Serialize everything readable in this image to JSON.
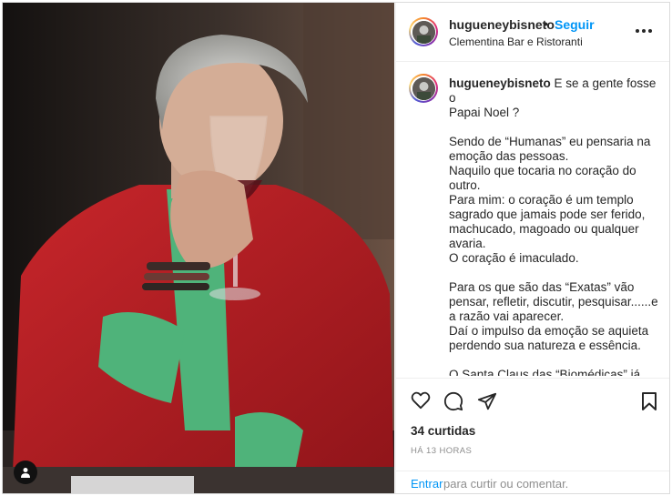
{
  "post": {
    "username": "hugueneybisneto",
    "separator": "•",
    "follow_label": "Seguir",
    "location": "Clementina Bar e Ristoranti",
    "more_icon": "more-horizontal-icon"
  },
  "caption": {
    "username": "hugueneybisneto",
    "lines": [
      "E se a gente fosse o",
      "Papai Noel ?",
      "",
      "Sendo de “Humanas” eu pensaria na",
      "emoção das pessoas.",
      "Naquilo que tocaria no coração do",
      "outro.",
      "Para mim: o coração é um templo",
      "sagrado que jamais pode ser ferido,",
      "machucado, magoado ou qualquer",
      "avaria.",
      "O coração é imaculado.",
      "",
      "Para os que são das “Exatas” vão",
      "pensar, refletir, discutir, pesquisar......e",
      "a razão vai aparecer.",
      "Daí o impulso da emoção se aquieta",
      "perdendo sua natureza e essência.",
      "",
      "O Santa Claus das “Biomédicas” já iria"
    ]
  },
  "actions": {
    "like_icon": "heart-icon",
    "comment_icon": "comment-icon",
    "share_icon": "share-icon",
    "save_icon": "bookmark-icon"
  },
  "likes": "34 curtidas",
  "timestamp": "HÁ 13 HORAS",
  "login": {
    "link_label": "Entrar",
    "rest_text": "para curtir ou comentar."
  },
  "colors": {
    "accent": "#0095f6",
    "border": "#dbdbdb",
    "muted": "#8e8e8e",
    "text": "#262626"
  }
}
